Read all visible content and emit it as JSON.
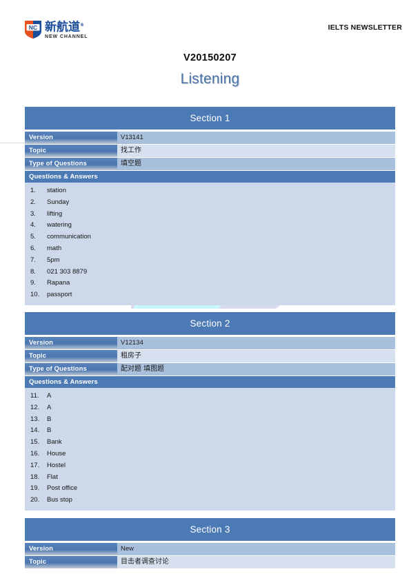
{
  "header": {
    "logo": {
      "mark_text": "NC",
      "chinese_name": "新航道",
      "english_name": "NEW CHANNEL",
      "trademark": "®"
    },
    "newsletter_label": "IELTS NEWSLETTER"
  },
  "title": {
    "version_code": "V20150207",
    "skill": "Listening"
  },
  "labels": {
    "version": "Version",
    "topic": "Topic",
    "type_of_questions": "Type of Questions",
    "questions_and_answers": "Questions & Answers"
  },
  "colors": {
    "section_header_blue": "#4c7ab5",
    "row_value_dark": "#a9c0dd",
    "row_value_light": "#d7e0ef",
    "qa_background": "#cdd9ea",
    "title_blue": "#4a73a8",
    "logo_blue": "#1b4e9b"
  },
  "sections": [
    {
      "name": "Section 1",
      "version": "V13141",
      "topic": "找工作",
      "type_of_questions": "填空题",
      "answers": [
        {
          "num": "1.",
          "text": "station"
        },
        {
          "num": "2.",
          "text": "Sunday"
        },
        {
          "num": "3.",
          "text": "lifting"
        },
        {
          "num": "4.",
          "text": "watering"
        },
        {
          "num": "5.",
          "text": "communication"
        },
        {
          "num": "6.",
          "text": "math"
        },
        {
          "num": "7.",
          "text": "5pm"
        },
        {
          "num": "8.",
          "text": "021 303 8879"
        },
        {
          "num": "9.",
          "text": "Rapana"
        },
        {
          "num": "10.",
          "text": "passport"
        }
      ]
    },
    {
      "name": "Section 2",
      "version": "V12134",
      "topic": "租房子",
      "type_of_questions": "配对题 填图题",
      "answers": [
        {
          "num": "11.",
          "text": "A"
        },
        {
          "num": "12.",
          "text": "A"
        },
        {
          "num": "13.",
          "text": "B"
        },
        {
          "num": "14.",
          "text": "B"
        },
        {
          "num": "15.",
          "text": "Bank"
        },
        {
          "num": "16.",
          "text": "House"
        },
        {
          "num": "17.",
          "text": "Hostel"
        },
        {
          "num": "18.",
          "text": "Flat"
        },
        {
          "num": "19.",
          "text": "Post office"
        },
        {
          "num": "20.",
          "text": "Bus stop"
        }
      ]
    },
    {
      "name": "Section 3",
      "version": "New",
      "topic": "目击者调查讨论",
      "type_of_questions": null,
      "answers": []
    }
  ]
}
